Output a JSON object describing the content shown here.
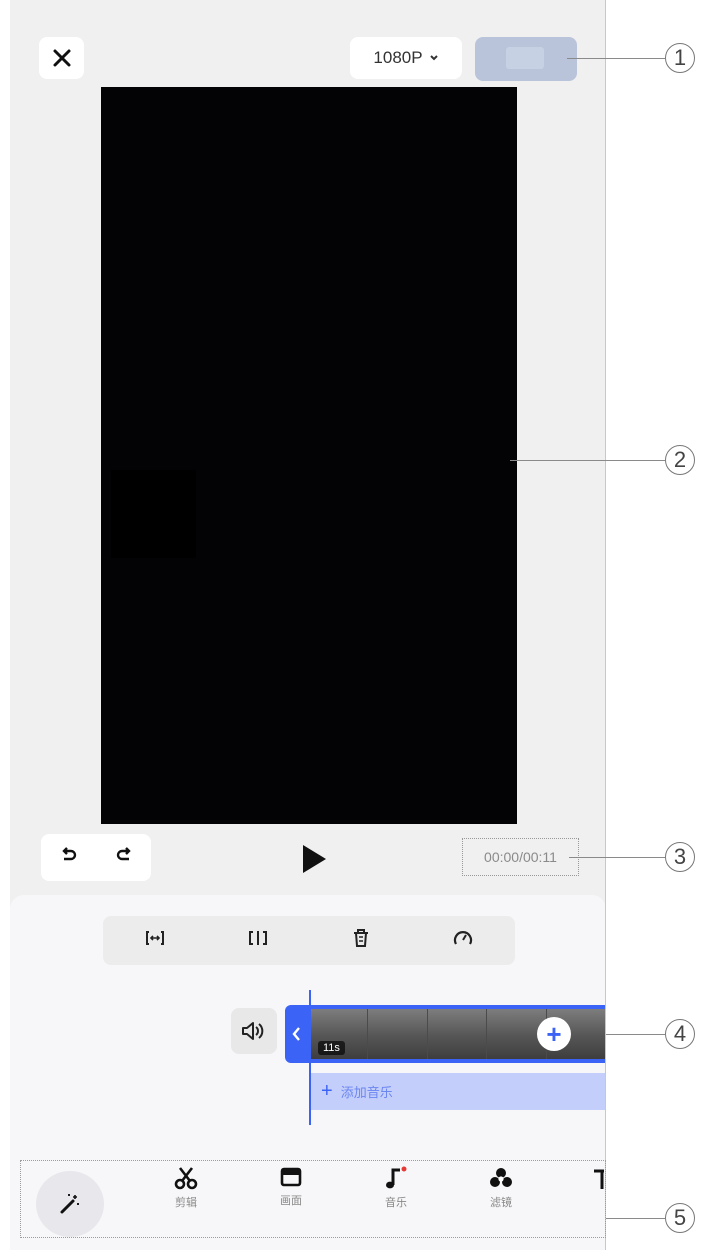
{
  "header": {
    "resolution": "1080P"
  },
  "timecode": "00:00/00:11",
  "timeline": {
    "clip_duration": "11s",
    "add_audio_label": "添加音乐"
  },
  "toolbar": {
    "items": [
      {
        "icon": "scissors-icon",
        "label": "剪辑"
      },
      {
        "icon": "canvas-icon",
        "label": "画面"
      },
      {
        "icon": "music-note-icon",
        "label": "音乐"
      },
      {
        "icon": "filter-icon",
        "label": "滤镜"
      }
    ]
  },
  "callouts": [
    "1",
    "2",
    "3",
    "4",
    "5"
  ],
  "colors": {
    "accent": "#3b63f5",
    "export_disabled": "#b9c4da",
    "audio_track": "#c4cefa"
  }
}
